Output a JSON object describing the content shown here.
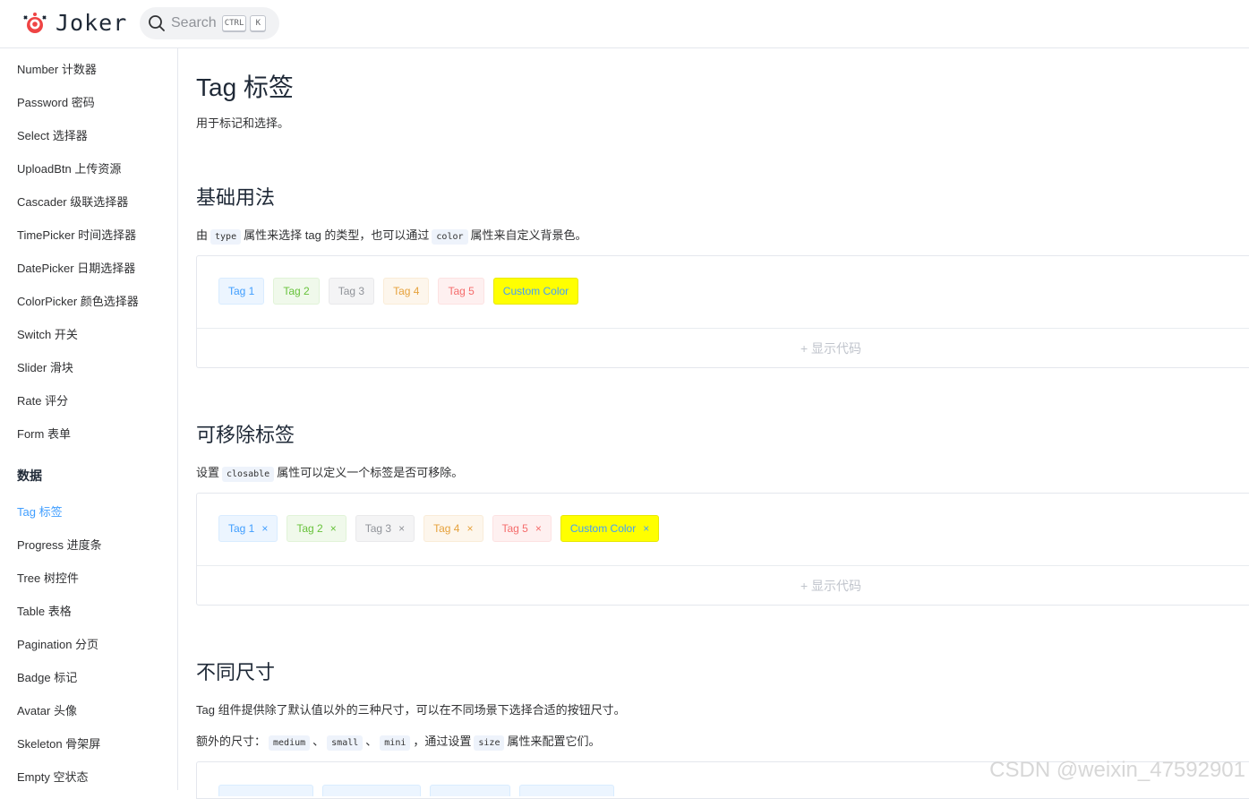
{
  "header": {
    "logo_text": "Joker",
    "search_placeholder": "Search",
    "kbd_ctrl": "CTRL",
    "kbd_k": "K"
  },
  "sidebar": {
    "items_top": [
      "Number 计数器",
      "Password 密码",
      "Select 选择器",
      "UploadBtn 上传资源",
      "Cascader 级联选择器",
      "TimePicker 时间选择器",
      "DatePicker 日期选择器",
      "ColorPicker 颜色选择器",
      "Switch 开关",
      "Slider 滑块",
      "Rate 评分",
      "Form 表单"
    ],
    "group_data": "数据",
    "items_data": [
      "Tag 标签",
      "Progress 进度条",
      "Tree 树控件",
      "Table 表格",
      "Pagination 分页",
      "Badge 标记",
      "Avatar 头像",
      "Skeleton 骨架屏",
      "Empty 空状态"
    ],
    "active": "Tag 标签"
  },
  "page": {
    "title": "Tag 标签",
    "subtitle": "用于标记和选择。"
  },
  "basic": {
    "heading": "基础用法",
    "desc_1": "由",
    "code_1": "type",
    "desc_2": "属性来选择 tag 的类型，也可以通过",
    "code_2": "color",
    "desc_3": "属性来自定义背景色。",
    "tags": [
      "Tag 1",
      "Tag 2",
      "Tag 3",
      "Tag 4",
      "Tag 5",
      "Custom Color"
    ],
    "show_code": "+ 显示代码"
  },
  "closable": {
    "heading": "可移除标签",
    "desc_1": "设置",
    "code_1": "closable",
    "desc_2": "属性可以定义一个标签是否可移除。",
    "tags": [
      "Tag 1",
      "Tag 2",
      "Tag 3",
      "Tag 4",
      "Tag 5",
      "Custom Color"
    ],
    "close_glyph": "×",
    "show_code": "+ 显示代码"
  },
  "sizes": {
    "heading": "不同尺寸",
    "desc_line1": "Tag 组件提供除了默认值以外的三种尺寸，可以在不同场景下选择合适的按钮尺寸。",
    "desc_a": "额外的尺寸：",
    "code_a": "medium",
    "sep_1": "、",
    "code_b": "small",
    "sep_2": "、",
    "code_c": "mini",
    "desc_b": "，通过设置",
    "code_d": "size",
    "desc_c": "属性来配置它们。"
  },
  "watermark": "CSDN @weixin_47592901",
  "colors": {
    "primary": "#409eff",
    "success": "#67c23a",
    "info": "#909399",
    "warning": "#e6a23c",
    "danger": "#f56c6c",
    "custom": "#ffff00"
  }
}
